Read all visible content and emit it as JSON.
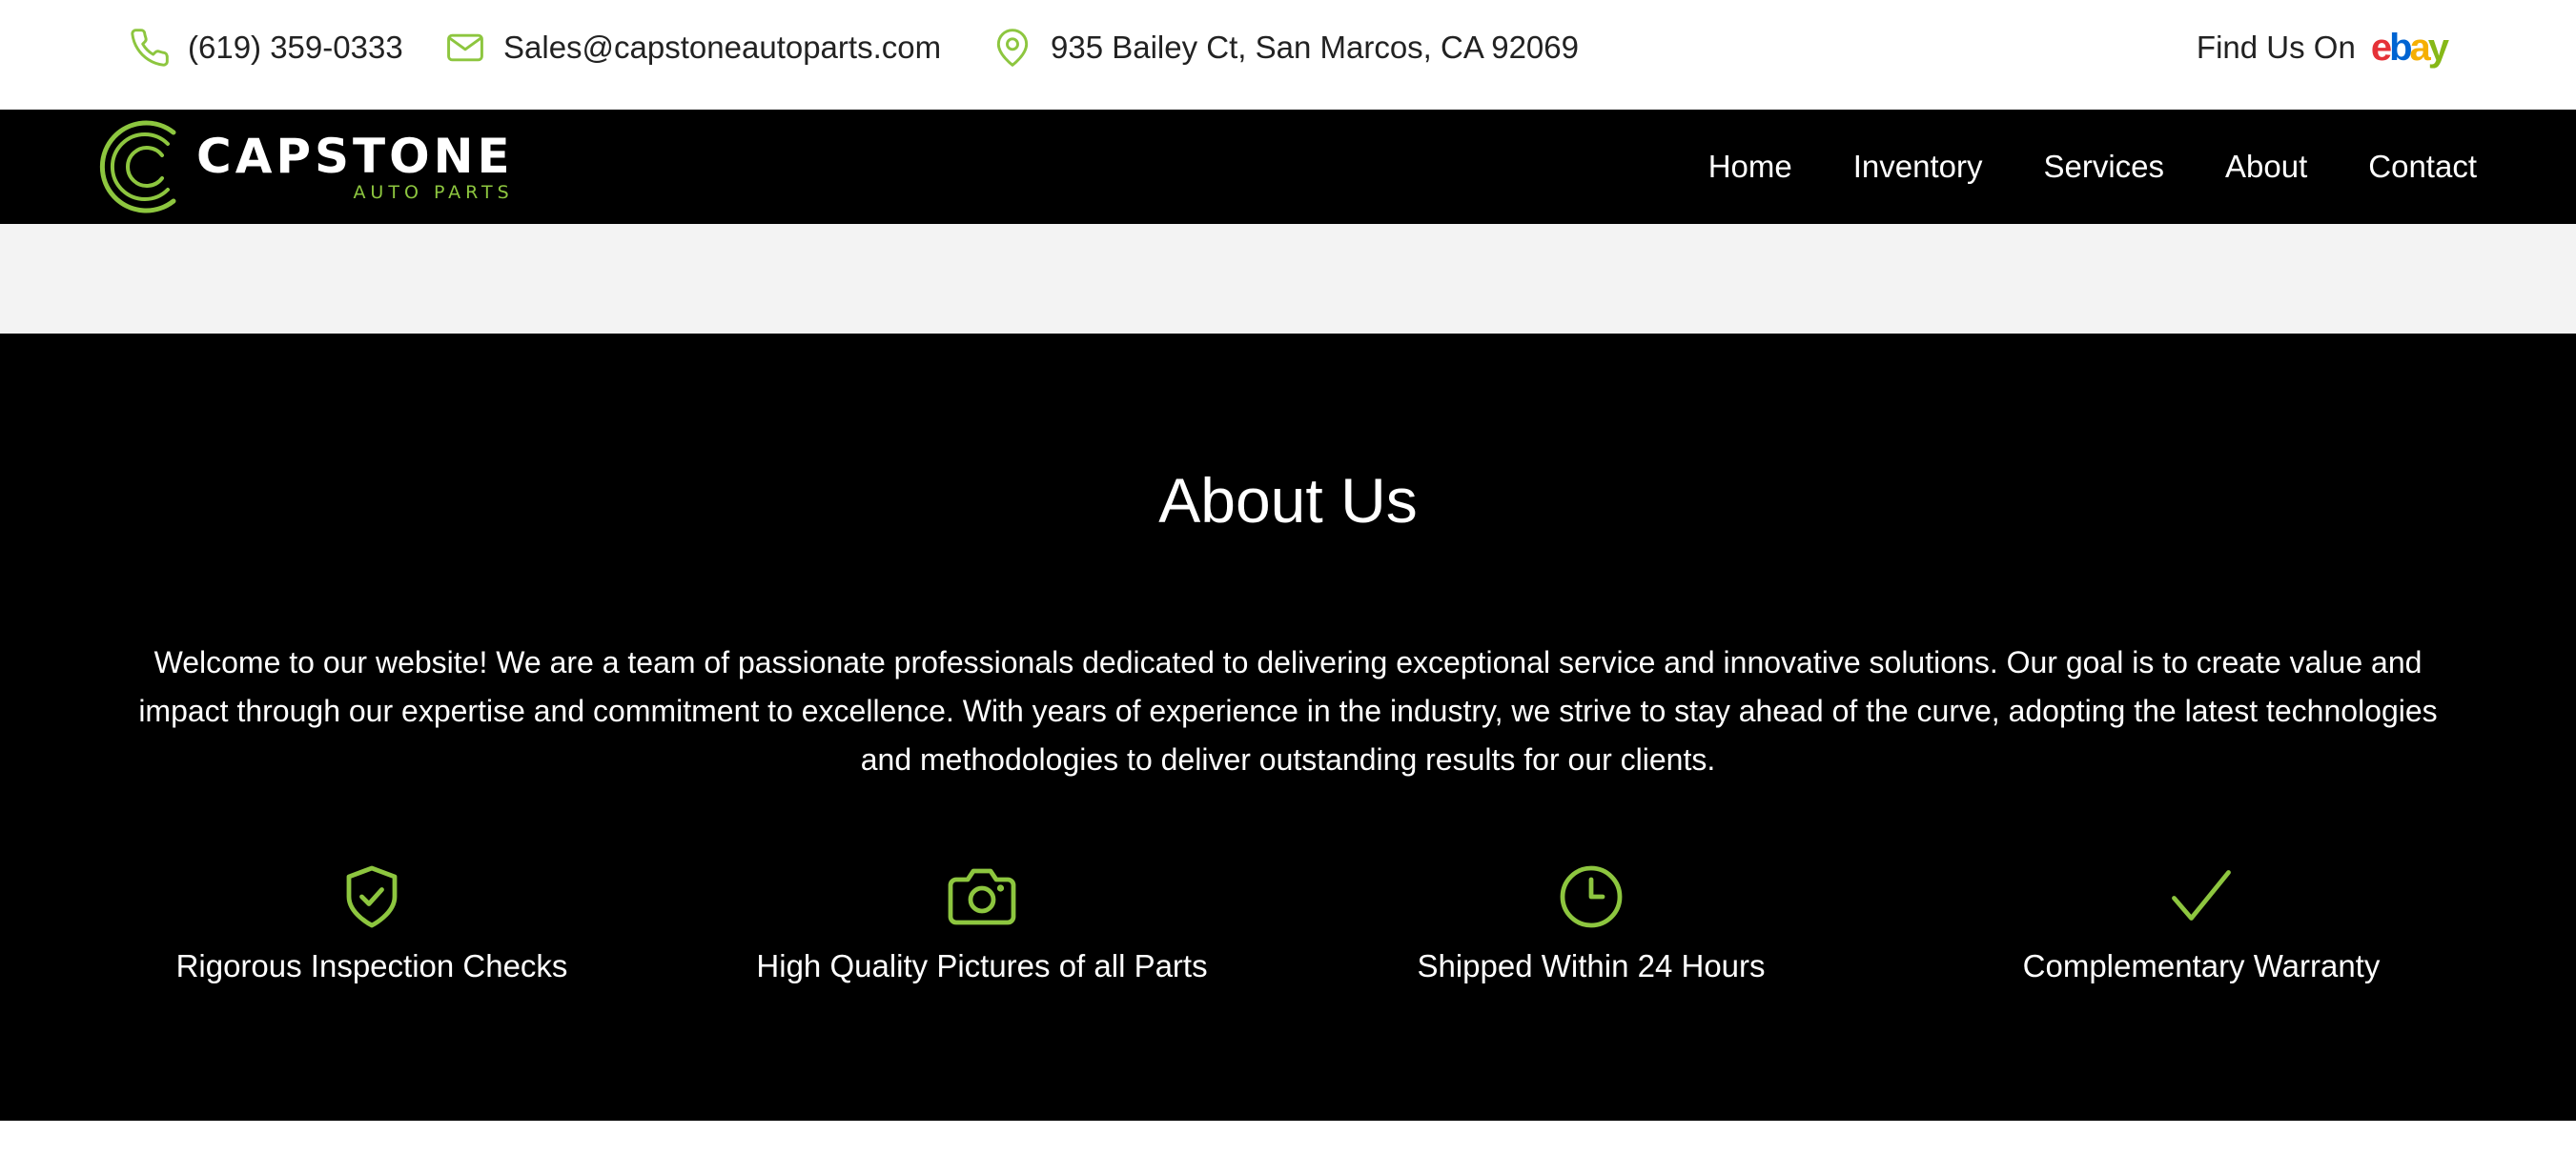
{
  "topbar": {
    "phone": "(619) 359-0333",
    "email": "Sales@capstoneautoparts.com",
    "address": "935 Bailey Ct, San Marcos, CA 92069",
    "find_us_label": "Find Us On",
    "ebay_letters": [
      "e",
      "b",
      "a",
      "y"
    ],
    "icons": [
      "phone-icon",
      "mail-icon",
      "map-pin-icon"
    ]
  },
  "brand": {
    "name": "CAPSTONE",
    "tagline": "AUTO PARTS",
    "accent_color": "#8dc63f"
  },
  "nav": {
    "items": [
      "Home",
      "Inventory",
      "Services",
      "About",
      "Contact"
    ]
  },
  "about": {
    "title": "About Us",
    "body": "Welcome to our website! We are a team of passionate professionals dedicated to delivering exceptional service and innovative solutions. Our goal is to create value and impact through our expertise and commitment to excellence. With years of experience in the industry, we strive to stay ahead of the curve, adopting the latest technologies and methodologies to deliver outstanding results for our clients.",
    "features": [
      {
        "icon": "shield-check-icon",
        "label": "Rigorous Inspection Checks"
      },
      {
        "icon": "camera-icon",
        "label": "High Quality Pictures of all Parts"
      },
      {
        "icon": "clock-icon",
        "label": "Shipped Within 24 Hours"
      },
      {
        "icon": "checkmark-icon",
        "label": "Complementary Warranty"
      }
    ]
  }
}
